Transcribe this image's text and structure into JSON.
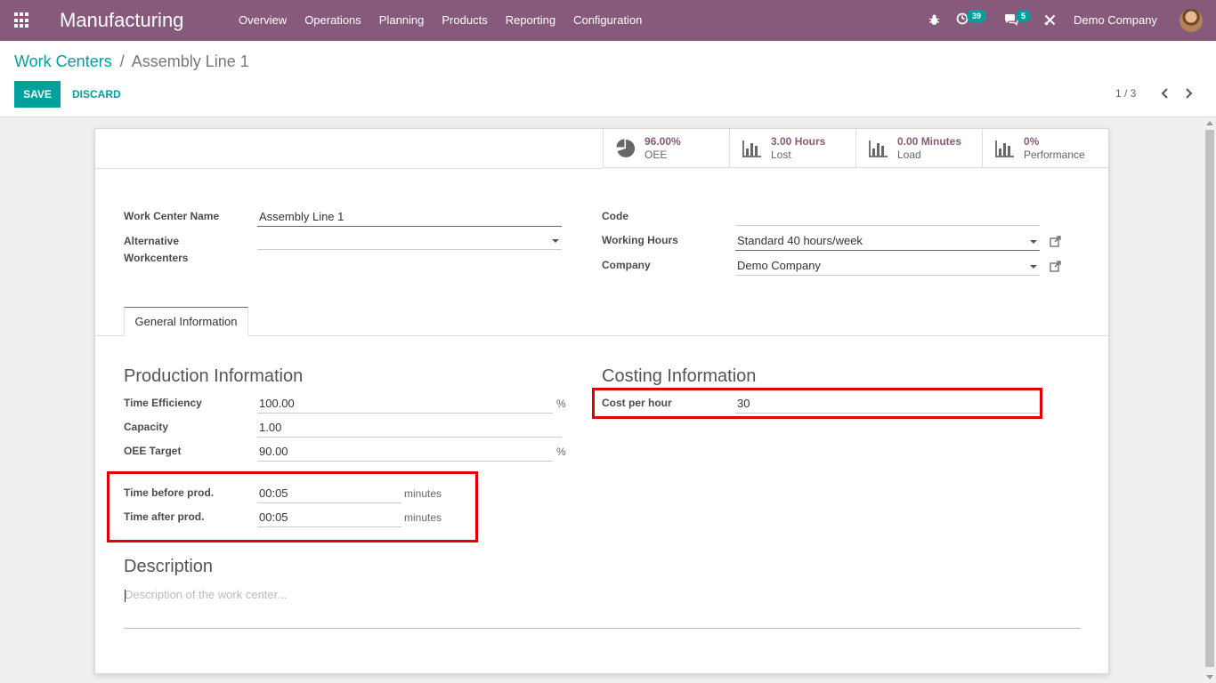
{
  "navbar": {
    "app_name": "Manufacturing",
    "menu": [
      "Overview",
      "Operations",
      "Planning",
      "Products",
      "Reporting",
      "Configuration"
    ],
    "activity_count": "39",
    "message_count": "5",
    "company": "Demo Company"
  },
  "control_panel": {
    "breadcrumb_parent": "Work Centers",
    "breadcrumb_separator": "/",
    "breadcrumb_current": "Assembly Line 1",
    "save_label": "SAVE",
    "discard_label": "DISCARD",
    "pager": "1 / 3"
  },
  "stats": [
    {
      "value": "96.00%",
      "label": "OEE",
      "icon": "pie-chart-icon"
    },
    {
      "value": "3.00 Hours",
      "label": "Lost",
      "icon": "bar-chart-icon"
    },
    {
      "value": "0.00 Minutes",
      "label": "Load",
      "icon": "bar-chart-icon"
    },
    {
      "value": "0%",
      "label": "Performance",
      "icon": "bar-chart-icon"
    }
  ],
  "form": {
    "work_center_name_label": "Work Center Name",
    "work_center_name": "Assembly Line 1",
    "alternative_label_1": "Alternative",
    "alternative_label_2": "Workcenters",
    "alternative_value": "",
    "code_label": "Code",
    "code_value": "",
    "working_hours_label": "Working Hours",
    "working_hours": "Standard 40 hours/week",
    "company_label": "Company",
    "company": "Demo Company"
  },
  "tab": {
    "general": "General Information"
  },
  "production": {
    "title": "Production Information",
    "time_efficiency_label": "Time Efficiency",
    "time_efficiency": "100.00",
    "percent": "%",
    "capacity_label": "Capacity",
    "capacity": "1.00",
    "oee_target_label": "OEE Target",
    "oee_target": "90.00",
    "time_before_label": "Time before prod.",
    "time_before": "00:05",
    "time_after_label": "Time after prod.",
    "time_after": "00:05",
    "minutes": "minutes"
  },
  "costing": {
    "title": "Costing Information",
    "cost_label": "Cost per hour",
    "cost": "30"
  },
  "description": {
    "title": "Description",
    "placeholder": "Description of the work center..."
  },
  "colors": {
    "brand": "#875a7b",
    "accent": "#00a09d",
    "highlight": "#e00000"
  }
}
